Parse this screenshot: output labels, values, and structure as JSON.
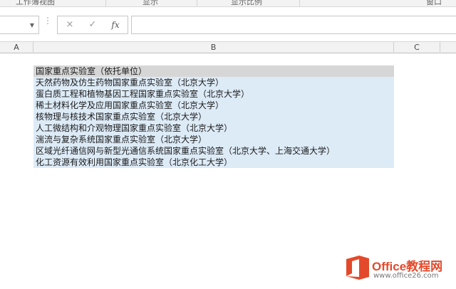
{
  "ribbon": {
    "groups": [
      "工作簿视图",
      "显示",
      "显示比例",
      "窗口"
    ]
  },
  "formula_bar": {
    "name_box_value": "",
    "cancel_icon": "×",
    "enter_icon": "✓",
    "fx_label": "fx",
    "formula_value": ""
  },
  "columns": [
    "A",
    "B",
    "C"
  ],
  "cells": {
    "header": "国家重点实验室（依托单位）",
    "rows": [
      "天然药物及仿生药物国家重点实验室（北京大学）",
      "蛋白质工程和植物基因工程国家重点实验室（北京大学）",
      "稀土材料化学及应用国家重点实验室（北京大学）",
      "核物理与核技术国家重点实验室（北京大学）",
      "人工微结构和介观物理国家重点实验室（北京大学）",
      "湍流与复杂系统国家重点实验室（北京大学）",
      "区域光纤通信网与新型光通信系统国家重点实验室（北京大学、上海交通大学）",
      "化工资源有效利用国家重点实验室（北京化工大学）"
    ]
  },
  "watermark": {
    "brand": "Office教程网",
    "url": "www.office26.com"
  },
  "colors": {
    "selection_fill": "#ddebf7",
    "header_fill": "#d6d6d6",
    "brand_orange": "#e34a2b"
  }
}
